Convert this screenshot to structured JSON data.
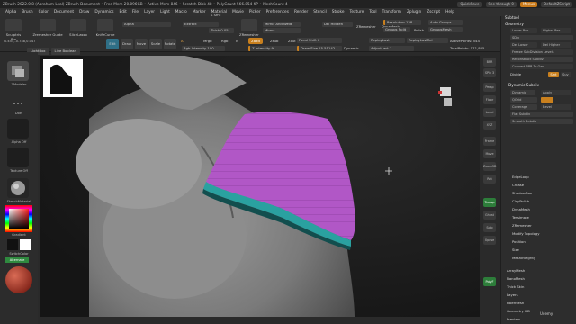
{
  "titlebar": {
    "title": "ZBrush 2022.0.8 (Abraham Leal)  ZBrush Document  • Free Mem 20.096GB • Active Mem 846 • Scratch Disk 48 • PolyCount 566.854 KP • MeshCount 4",
    "quicksave": "QuickSave",
    "seethrough": "See-through 0",
    "menus": "Menus",
    "default_script": "DefaultZScript"
  },
  "menubar": [
    "Alpha",
    "Brush",
    "Color",
    "Document",
    "Draw",
    "Dynamics",
    "Edit",
    "File",
    "Layer",
    "Light",
    "Macro",
    "Marker",
    "Material",
    "Movie",
    "Picker",
    "Preferences",
    "Render",
    "Stencil",
    "Stroke",
    "Texture",
    "Tool",
    "Transform",
    "Zplugin",
    "Zscript",
    "Help"
  ],
  "shelf": {
    "tools": [
      {
        "label": "Sculptris Pro"
      },
      {
        "label": "Zremesher Guide"
      },
      {
        "label": "SliceLasso"
      },
      {
        "label": "KnifeCurve"
      }
    ],
    "modes": [
      "Edit",
      "Draw",
      "Move",
      "Scale",
      "Rotate"
    ],
    "a_label": "A",
    "mrgb": "Mrgb",
    "rgb": "Rgb",
    "m": "M",
    "zadd": "Zadd",
    "zsub": "Zsub",
    "zcut": "Zcut",
    "rgb_intensity": "Rgb Intensity 100",
    "z_intensity": "Z Intensity 9",
    "focal_shift": "Focal Shift 0",
    "draw_size": "Draw Size 15.55142",
    "dynamic": "Dynamic",
    "replay_last": "ReplayLast",
    "replay_last_rel": "ReplayLastRel",
    "active_points": "ActivePoints: 544",
    "adjust_last": "AdjustLast 1",
    "total_points": "TotalPoints: 571,865",
    "polish_label": "Polish",
    "resolution": "Resolution 128",
    "groups_split": "Groups Split",
    "auto_groups": "Auto Groups",
    "group_mesh": "GroupsMesh",
    "del_hidden": "Del Hidden",
    "mirror": "Mirror",
    "mirror_weld": "Mirror And Weld",
    "zremesher": "ZRemesher",
    "dynamesh": "DynaMesh",
    "extract": "Extract",
    "s_smt": "S Smt",
    "thick": "Thick 0.05",
    "alpha_label": "Alpha"
  },
  "coords": "0.455,-0.748,0.047",
  "lightbar": [
    "LightBox",
    "Live Boolean"
  ],
  "lefttray": {
    "brush_label": "ZModeler",
    "stroke_label": "Dots",
    "alpha_label": "Alpha Off",
    "texture_label": "Texture Off",
    "material_label": "SketchMaterial",
    "gradient_label": "Gradient",
    "switch_label": "SwitchColor",
    "alternate_label": "Alternate"
  },
  "rightstrip": [
    "BPR",
    "SPix 3",
    "Persp",
    "Floor",
    "Local",
    "XYZ",
    "Frame",
    "Move",
    "Zoom3D",
    "Rot",
    "Transp",
    "Ghost",
    "Solo",
    "Xpose",
    "PolyF"
  ],
  "rpanel": {
    "subtool": "Subtool",
    "geometry": "Geometry",
    "lower_res": "Lower Res",
    "higher_res": "Higher Res",
    "sdiv": "SDiv",
    "del_lower": "Del Lower",
    "del_higher": "Del Higher",
    "freeze": "Freeze SubDivision Levels",
    "reconstruct": "Reconstruct Subdiv",
    "convert_bpr": "Convert BPR To Geo",
    "divide": "Divide",
    "smt": "Smt",
    "suv": "Suv",
    "dynamic_subdiv": "Dynamic Subdiv",
    "dynamic": "Dynamic",
    "apply": "Apply",
    "qgrid": "QGrid",
    "coverage": "Coverage",
    "bevel": "Bevel",
    "flat_subdiv": "Flat Subdiv",
    "smooth_subdiv": "Smooth Subdiv",
    "items": [
      "EdgeLoop",
      "Crease",
      "ShadowBox",
      "ClayPolish",
      "DynaMesh",
      "Tessimate",
      "ZRemesher",
      "Modify Topology",
      "Position",
      "Size",
      "MeshIntegrity"
    ],
    "items2": [
      "ArrayMesh",
      "NanoMesh",
      "Thick Skin",
      "Layers",
      "FiberMesh",
      "Geometry HD",
      "Preview"
    ]
  },
  "watermark": "Udemy"
}
